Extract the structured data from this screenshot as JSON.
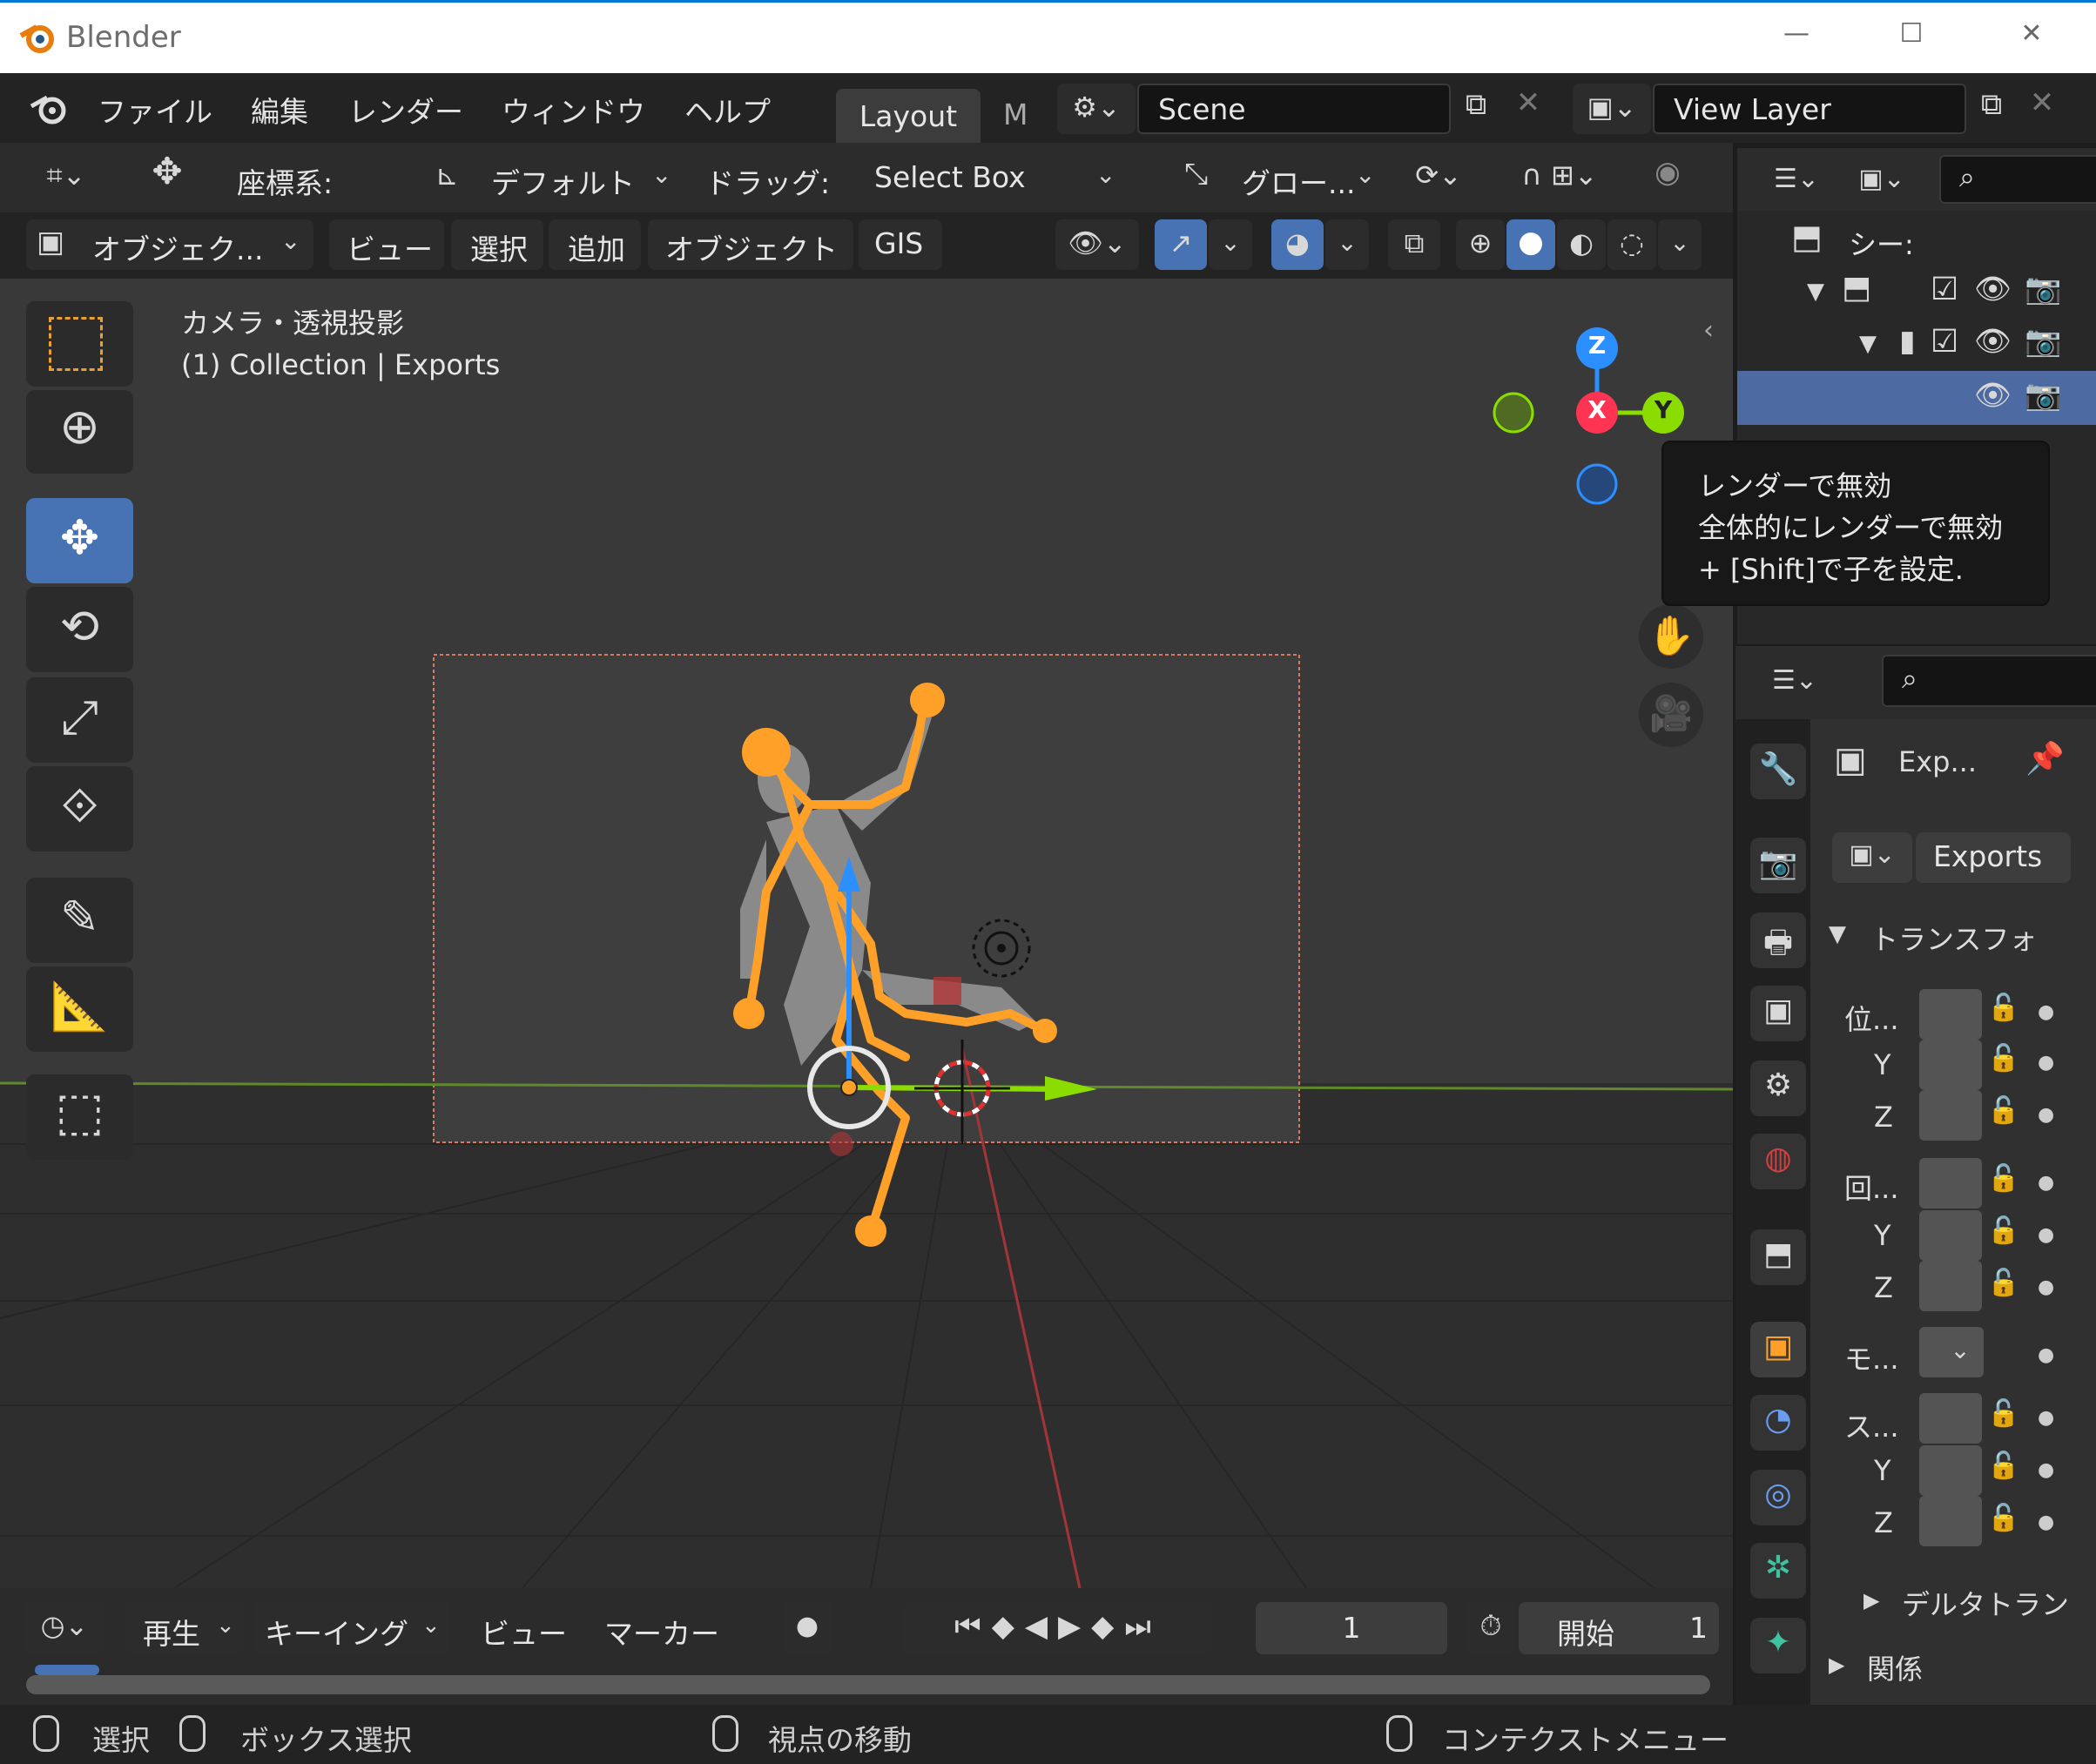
{
  "titlebar": {
    "app_title": "Blender",
    "minimize": "—",
    "maximize": "☐",
    "close": "✕"
  },
  "menubar": {
    "menus": [
      "ファイル",
      "編集",
      "レンダー",
      "ウィンドウ",
      "ヘルプ"
    ],
    "workspace_tabs": [
      "Layout",
      "M"
    ],
    "scene": "Scene",
    "view_layer": "View Layer"
  },
  "tool_header": {
    "coord_label": "座標系:",
    "coord_value": "デフォルト",
    "drag_label": "ドラッグ:",
    "drag_value": "Select Box",
    "pivot_value": "グロー..."
  },
  "viewport_header": {
    "mode": "オブジェク...",
    "menus": [
      "ビュー",
      "選択",
      "追加",
      "オブジェクト",
      "GIS"
    ]
  },
  "viewport": {
    "view_name": "カメラ・透視投影",
    "collection_info": "(1) Collection | Exports"
  },
  "gizmo": {
    "z": "Z",
    "x": "X",
    "y": "Y"
  },
  "tooltip": {
    "line1": "レンダーで無効",
    "line2": "全体的にレンダーで無効",
    "line3": "+ [Shift]で子を設定."
  },
  "outliner": {
    "root_label": "シー:"
  },
  "properties": {
    "object_short": "Exp...",
    "object_name": "Exports",
    "transform_panel": "トランスフォ",
    "location_label": "位...",
    "rotation_label": "回...",
    "mode_label": "モ...",
    "scale_label": "ス...",
    "axis_y": "Y",
    "axis_z": "Z",
    "delta_panel": "デルタトラン",
    "relations_panel": "関係"
  },
  "timeline": {
    "menus": [
      "再生",
      "キーイング",
      "ビュー",
      "マーカー"
    ],
    "current_frame": "1",
    "start_label": "開始",
    "start_value": "1"
  },
  "statusbar": {
    "select": "選択",
    "box_select": "ボックス選択",
    "rotate_view": "視点の移動",
    "context_menu": "コンテクストメニュー"
  },
  "colors": {
    "active_tool": "#4772b3",
    "selection_orange": "#ffa028",
    "x_axis": "#ff3352",
    "y_axis": "#8bdc00",
    "z_axis": "#2c8fff",
    "outliner_highlight": "#4e6aa3"
  }
}
